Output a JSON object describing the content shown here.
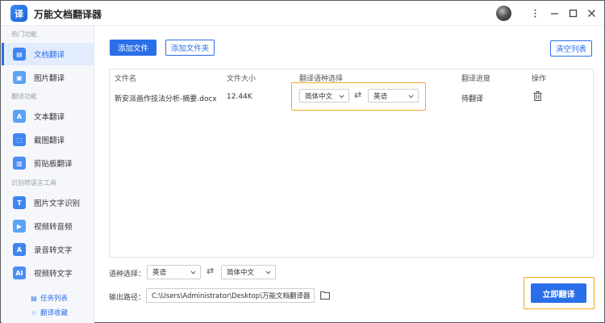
{
  "app": {
    "title": "万能文档翻译器",
    "logo_text": "译"
  },
  "sidebar": {
    "sections": [
      {
        "label": "热门功能"
      },
      {
        "label": "翻译功能"
      },
      {
        "label": "识别转语言工具"
      }
    ],
    "items": [
      {
        "label": "文档翻译",
        "icon": "document-icon",
        "glyph": "▤",
        "active": true
      },
      {
        "label": "图片翻译",
        "icon": "image-icon",
        "glyph": "▣"
      },
      {
        "label": "文本翻译",
        "icon": "text-icon",
        "glyph": "A"
      },
      {
        "label": "截图翻译",
        "icon": "screenshot-icon",
        "glyph": "⬚"
      },
      {
        "label": "剪贴板翻译",
        "icon": "clipboard-icon",
        "glyph": "▥"
      },
      {
        "label": "图片文字识别",
        "icon": "ocr-icon",
        "glyph": "T"
      },
      {
        "label": "视频转音频",
        "icon": "video-audio-icon",
        "glyph": "▶"
      },
      {
        "label": "录音转文字",
        "icon": "recording-icon",
        "glyph": "A"
      },
      {
        "label": "视频转文字",
        "icon": "video-text-icon",
        "glyph": "AI"
      }
    ],
    "links": [
      {
        "label": "任务列表",
        "icon": "task-list-icon",
        "glyph": "▤"
      },
      {
        "label": "翻译收藏",
        "icon": "star-icon",
        "glyph": "☆"
      }
    ]
  },
  "toolbar": {
    "add_file": "添加文件",
    "add_folder": "添加文件夹",
    "clear_list": "清空列表"
  },
  "table": {
    "headers": [
      "文件名",
      "文件大小",
      "翻译语种选择",
      "翻译进度",
      "操作"
    ],
    "rows": [
      {
        "file_name": "新安派画作技法分析-摘要.docx",
        "size": "12.44K",
        "source_lang": "简体中文",
        "target_lang": "英语",
        "progress": "待翻译"
      }
    ]
  },
  "footer": {
    "lang_label": "语种选择：",
    "source_lang": "英语",
    "target_lang": "简体中文",
    "output_label": "输出路径：",
    "output_path": "C:\\Users\\Administrator\\Desktop\\万能文档翻译器",
    "start": "立即翻译"
  },
  "colors": {
    "accent": "#2a6ee8",
    "highlight": "#f5a623",
    "sidebar_bg": "#f5f7fb"
  }
}
